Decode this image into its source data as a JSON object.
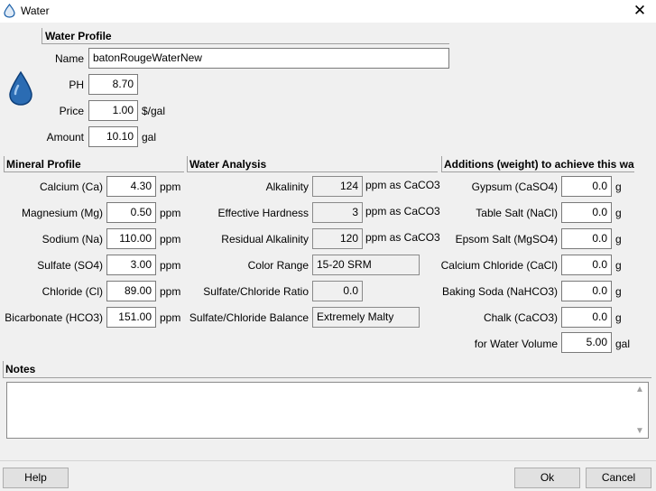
{
  "window": {
    "title": "Water",
    "icon": "water-drop-icon",
    "close_label": "✕"
  },
  "water_profile": {
    "header": "Water Profile",
    "name_label": "Name",
    "name_value": "batonRougeWaterNew",
    "ph_label": "PH",
    "ph_value": "8.70",
    "price_label": "Price",
    "price_value": "1.00",
    "price_unit": "$/gal",
    "amount_label": "Amount",
    "amount_value": "10.10",
    "amount_unit": "gal"
  },
  "mineral_profile": {
    "header": "Mineral Profile",
    "unit": "ppm",
    "rows": [
      {
        "label": "Calcium (Ca)",
        "value": "4.30"
      },
      {
        "label": "Magnesium (Mg)",
        "value": "0.50"
      },
      {
        "label": "Sodium (Na)",
        "value": "110.00"
      },
      {
        "label": "Sulfate (SO4)",
        "value": "3.00"
      },
      {
        "label": "Chloride (Cl)",
        "value": "89.00"
      },
      {
        "label": "Bicarbonate (HCO3)",
        "value": "151.00"
      }
    ]
  },
  "water_analysis": {
    "header": "Water Analysis",
    "rows": [
      {
        "label": "Alkalinity",
        "value": "124",
        "unit": "ppm as CaCO3"
      },
      {
        "label": "Effective Hardness",
        "value": "3",
        "unit": "ppm as CaCO3"
      },
      {
        "label": "Residual Alkalinity",
        "value": "120",
        "unit": "ppm as CaCO3"
      },
      {
        "label": "Color Range",
        "value": "15-20 SRM",
        "unit": ""
      },
      {
        "label": "Sulfate/Chloride Ratio",
        "value": "0.0",
        "unit": ""
      },
      {
        "label": "Sulfate/Chloride Balance",
        "value": "Extremely Malty",
        "unit": ""
      }
    ]
  },
  "additions": {
    "header": "Additions (weight) to achieve this wat",
    "unit": "g",
    "rows": [
      {
        "label": "Gypsum (CaSO4)",
        "value": "0.0"
      },
      {
        "label": "Table Salt (NaCl)",
        "value": "0.0"
      },
      {
        "label": "Epsom Salt (MgSO4)",
        "value": "0.0"
      },
      {
        "label": "Calcium Chloride (CaCl)",
        "value": "0.0"
      },
      {
        "label": "Baking Soda (NaHCO3)",
        "value": "0.0"
      },
      {
        "label": "Chalk (CaCO3)",
        "value": "0.0"
      }
    ],
    "volume_label": "for Water Volume",
    "volume_value": "5.00",
    "volume_unit": "gal"
  },
  "notes": {
    "header": "Notes",
    "value": ""
  },
  "buttons": {
    "help": "Help",
    "ok": "Ok",
    "cancel": "Cancel"
  },
  "colors": {
    "drop": "#1a5fa8",
    "drop_highlight": "#9fc6ee"
  }
}
